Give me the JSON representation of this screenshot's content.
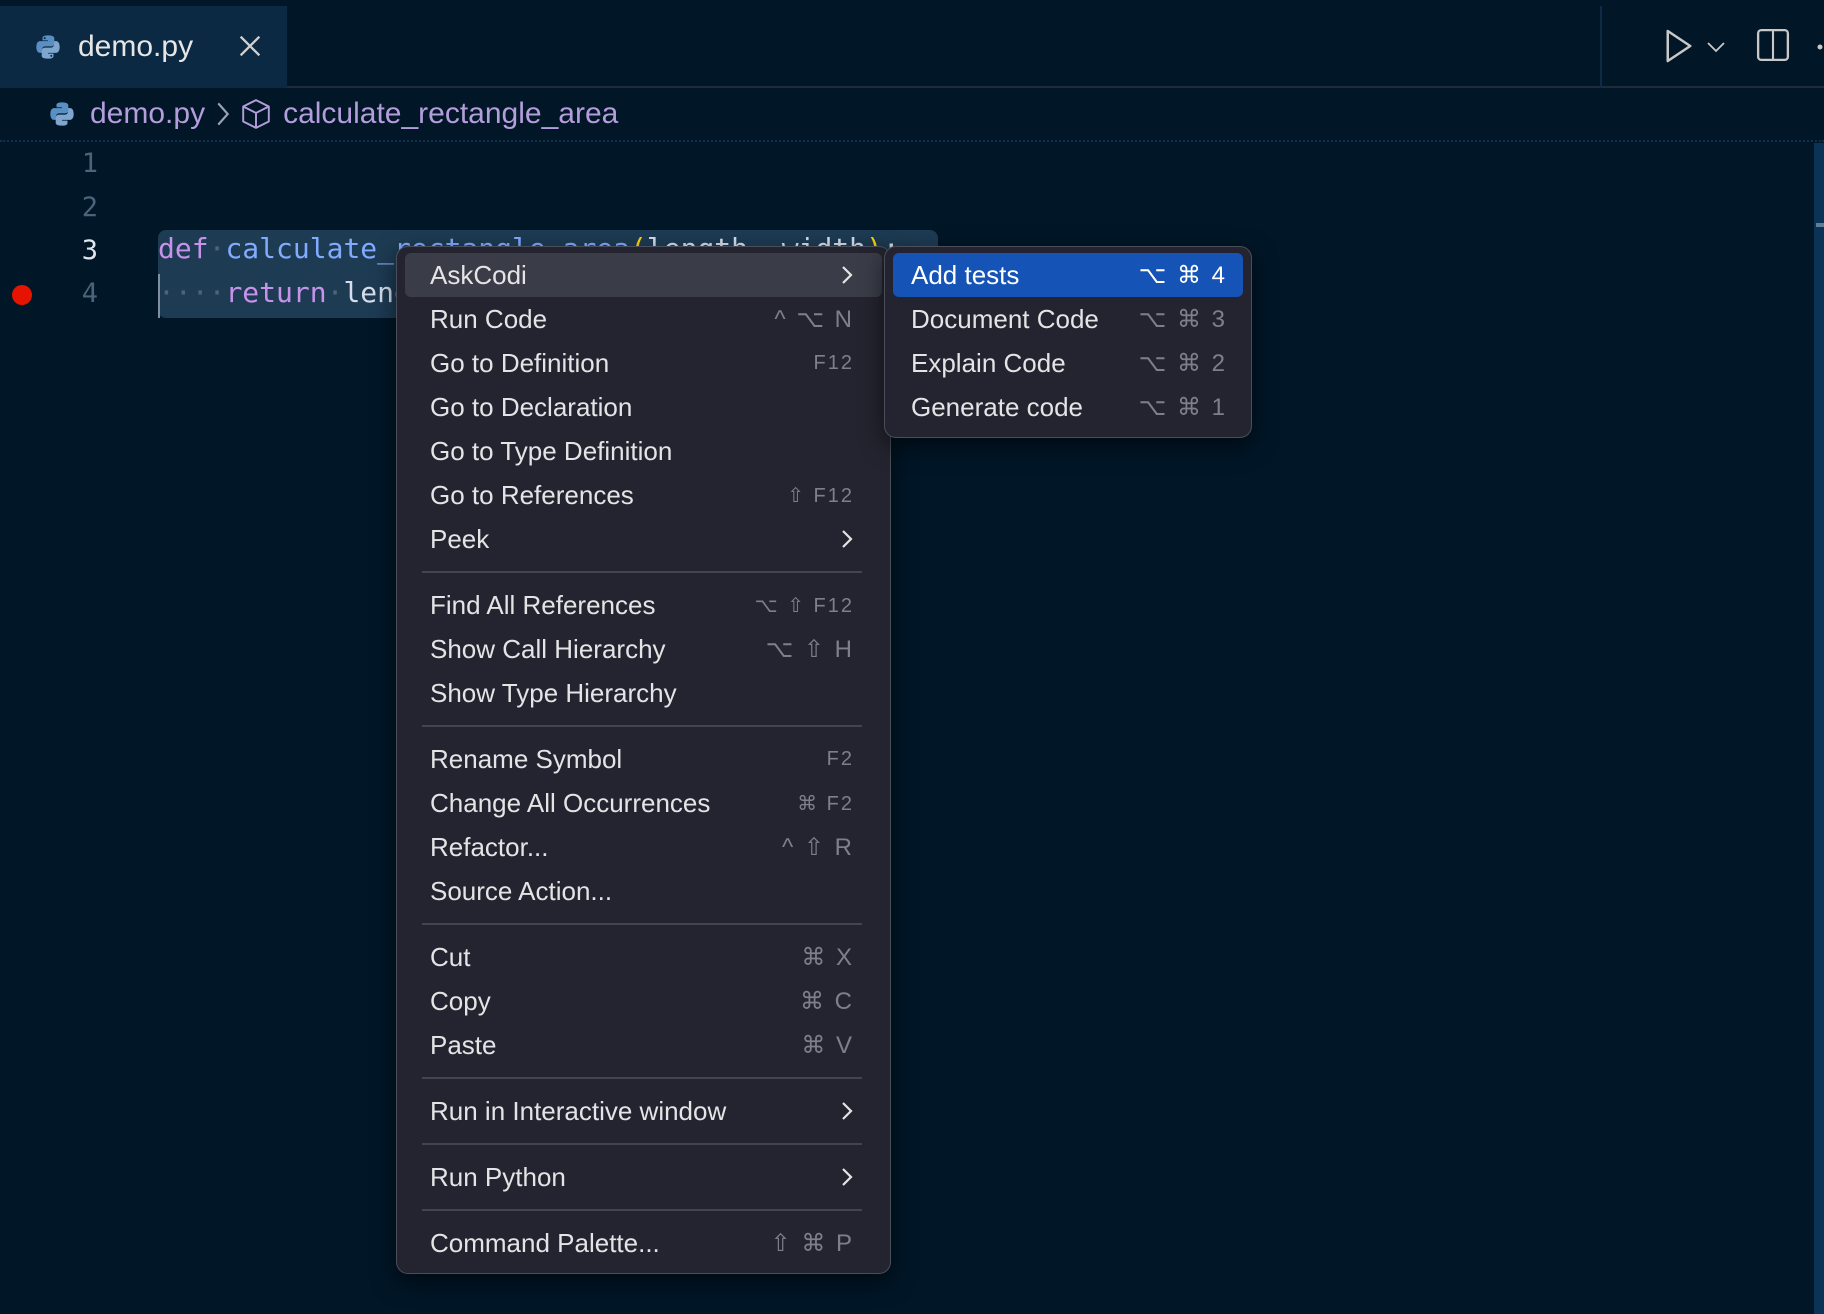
{
  "tab": {
    "filename": "demo.py",
    "file_icon": "python-icon",
    "close_icon": "close-icon"
  },
  "editor_actions": {
    "run_icon": "play-icon",
    "run_dropdown_icon": "chevron-down-icon",
    "split_icon": "split-editor-icon",
    "more_icon": "ellipsis-icon"
  },
  "breadcrumb": {
    "file": "demo.py",
    "separator_icon": "chevron-right-icon",
    "symbol_icon": "cube-icon",
    "symbol": "calculate_rectangle_area"
  },
  "editor": {
    "line_numbers": [
      "1",
      "2",
      "3",
      "4"
    ],
    "active_line": "3",
    "breakpoint_line": "4",
    "line3": {
      "kw": "def",
      "ws": "·",
      "fn": "calculate_rectangle_area",
      "open": "(",
      "args": "length, width",
      "close": ")",
      "colon": ":"
    },
    "line4": {
      "indent": "····",
      "kw": "return",
      "ws": "·",
      "rest": "length * width"
    }
  },
  "context_menu": {
    "items": [
      {
        "label": "AskCodi",
        "shortcut": "",
        "submenu": true
      },
      {
        "label": "Run Code",
        "shortcut": "^ ⌥ N"
      },
      {
        "label": "Go to Definition",
        "shortcut": "F12"
      },
      {
        "label": "Go to Declaration",
        "shortcut": ""
      },
      {
        "label": "Go to Type Definition",
        "shortcut": ""
      },
      {
        "label": "Go to References",
        "shortcut": "⇧ F12"
      },
      {
        "label": "Peek",
        "shortcut": "",
        "submenu": true
      },
      {
        "label": "Find All References",
        "shortcut": "⌥ ⇧ F12"
      },
      {
        "label": "Show Call Hierarchy",
        "shortcut": "⌥ ⇧ H"
      },
      {
        "label": "Show Type Hierarchy",
        "shortcut": ""
      },
      {
        "label": "Rename Symbol",
        "shortcut": "F2"
      },
      {
        "label": "Change All Occurrences",
        "shortcut": "⌘ F2"
      },
      {
        "label": "Refactor...",
        "shortcut": "^ ⇧ R"
      },
      {
        "label": "Source Action...",
        "shortcut": ""
      },
      {
        "label": "Cut",
        "shortcut": "⌘ X"
      },
      {
        "label": "Copy",
        "shortcut": "⌘ C"
      },
      {
        "label": "Paste",
        "shortcut": "⌘ V"
      },
      {
        "label": "Run in Interactive window",
        "shortcut": "",
        "submenu": true
      },
      {
        "label": "Run Python",
        "shortcut": "",
        "submenu": true
      },
      {
        "label": "Command Palette...",
        "shortcut": "⇧ ⌘ P"
      }
    ]
  },
  "askcodi_submenu": {
    "items": [
      {
        "label": "Add tests",
        "shortcut": "⌥ ⌘ 4",
        "highlighted": true
      },
      {
        "label": "Document Code",
        "shortcut": "⌥ ⌘ 3"
      },
      {
        "label": "Explain Code",
        "shortcut": "⌥ ⌘ 2"
      },
      {
        "label": "Generate code",
        "shortcut": "⌥ ⌘ 1"
      }
    ]
  },
  "colors": {
    "background": "#011627",
    "accent": "#1553b6",
    "breakpoint": "#e51400",
    "menu_bg": "#23242f"
  }
}
